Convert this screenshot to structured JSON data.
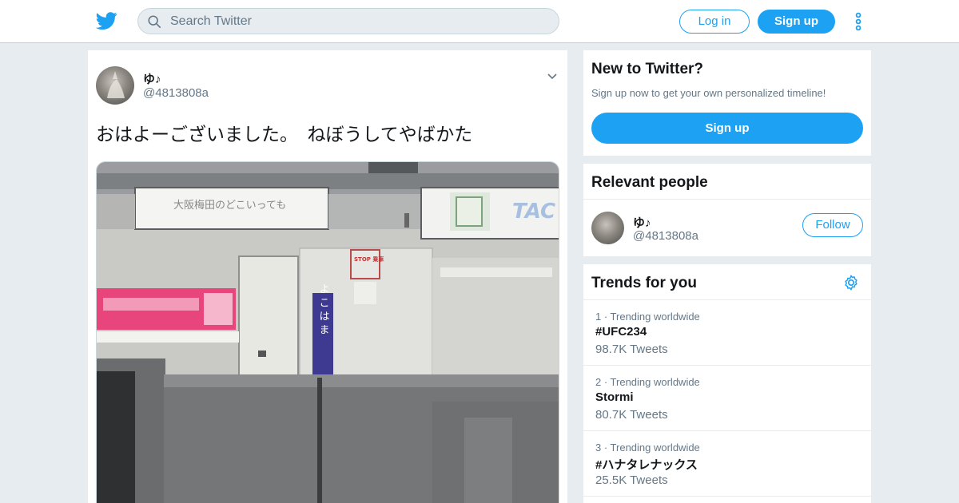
{
  "header": {
    "search_placeholder": "Search Twitter",
    "login_label": "Log in",
    "signup_label": "Sign up",
    "icons": [
      "twitter-bird-icon",
      "search-icon",
      "more-vertical-icon"
    ]
  },
  "tweet": {
    "author_name": "ゆ♪",
    "author_handle": "@4813808a",
    "text": "おはよーございました。　ねぼうしてやばかた",
    "photo_signs": {
      "sign_left": "大阪梅田のどこいっても",
      "sign_right_brand": "TAC",
      "station_sign": "よこはま",
      "stop_sign": "STOP 乗車"
    }
  },
  "new_to_twitter": {
    "title": "New to Twitter?",
    "subtitle": "Sign up now to get your own personalized timeline!",
    "button": "Sign up"
  },
  "relevant_people": {
    "title": "Relevant people",
    "name": "ゆ♪",
    "handle": "@4813808a",
    "follow_label": "Follow"
  },
  "trends": {
    "title": "Trends for you",
    "items": [
      {
        "meta": "1 · Trending worldwide",
        "name": "#UFC234",
        "count": "98.7K Tweets"
      },
      {
        "meta": "2 · Trending worldwide",
        "name": "Stormi",
        "count": "80.7K Tweets"
      },
      {
        "meta": "3 · Trending worldwide",
        "name": "#ハナタレナックス",
        "count": "25.5K Tweets"
      }
    ]
  },
  "colors": {
    "accent": "#1da1f2",
    "background": "#e6ecf0",
    "secondary_text": "#657786"
  }
}
